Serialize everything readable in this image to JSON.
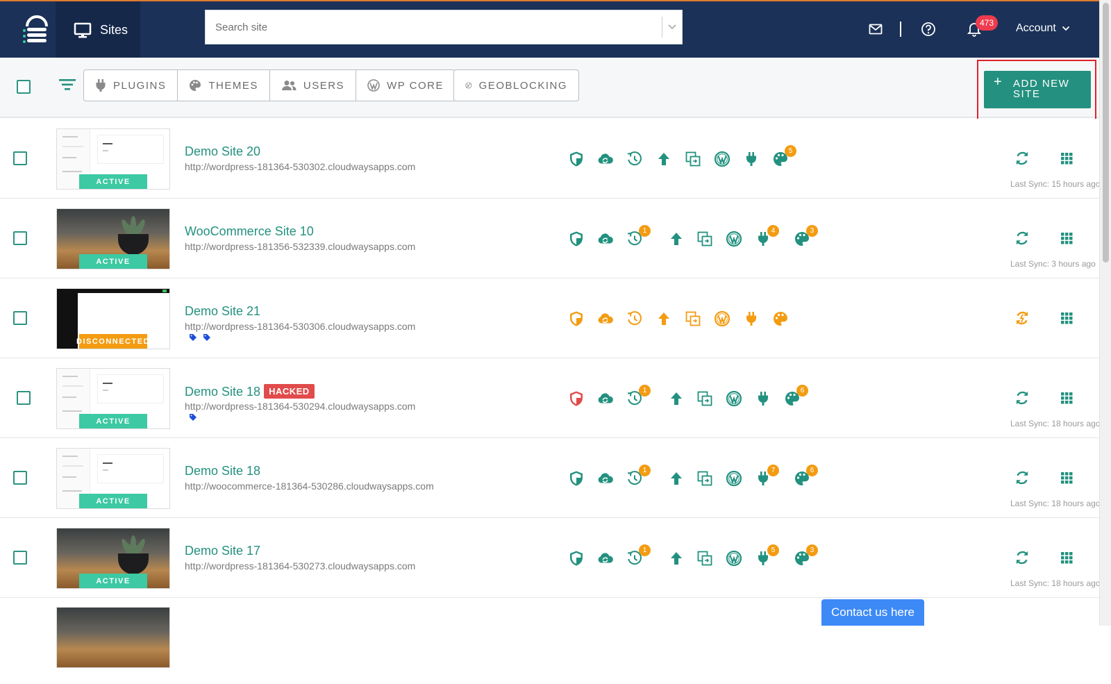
{
  "header": {
    "nav_label": "Sites",
    "search_placeholder": "Search site",
    "notifications_count": "473",
    "account_label": "Account"
  },
  "toolbar": {
    "buttons": [
      "PLUGINS",
      "THEMES",
      "USERS",
      "WP CORE"
    ],
    "geoblocking_label": "GEOBLOCKING",
    "add_new_site_label": "ADD NEW SITE"
  },
  "status_labels": {
    "active": "ACTIVE",
    "disconnected": "DISCONNECTED",
    "hacked": "HACKED"
  },
  "colors": {
    "teal": "#23917f",
    "orange": "#f39c12",
    "red": "#e24b4b",
    "nav": "#1b3158"
  },
  "sites": [
    {
      "name": "Demo Site 20",
      "url": "http://wordpress-181364-530302.cloudwaysapps.com",
      "status": "ACTIVE",
      "thumb": "doc",
      "hacked": false,
      "backup_badge": "",
      "plugin_badge": "",
      "theme_badge": "5",
      "last_sync": "Last Sync: 15 hours ago",
      "tags": 0
    },
    {
      "name": "WooCommerce Site 10",
      "url": "http://wordpress-181356-532339.cloudwaysapps.com",
      "status": "ACTIVE",
      "thumb": "photo",
      "hacked": false,
      "backup_badge": "1",
      "plugin_badge": "4",
      "theme_badge": "3",
      "last_sync": "Last Sync: 3 hours ago",
      "tags": 0
    },
    {
      "name": "Demo Site 21",
      "url": "http://wordpress-181364-530306.cloudwaysapps.com",
      "status": "DISCONNECTED",
      "thumb": "dark",
      "hacked": false,
      "backup_badge": "",
      "plugin_badge": "",
      "theme_badge": "",
      "last_sync": "",
      "tags": 2
    },
    {
      "name": "Demo Site 18",
      "url": "http://wordpress-181364-530294.cloudwaysapps.com",
      "status": "ACTIVE",
      "thumb": "doc",
      "hacked": true,
      "backup_badge": "1",
      "plugin_badge": "",
      "theme_badge": "6",
      "last_sync": "Last Sync: 18 hours ago",
      "tags": 1
    },
    {
      "name": "Demo Site 18",
      "url": "http://woocommerce-181364-530286.cloudwaysapps.com",
      "status": "ACTIVE",
      "thumb": "doc",
      "hacked": false,
      "backup_badge": "1",
      "plugin_badge": "7",
      "theme_badge": "6",
      "last_sync": "Last Sync: 18 hours ago",
      "tags": 0
    },
    {
      "name": "Demo Site 17",
      "url": "http://wordpress-181364-530273.cloudwaysapps.com",
      "status": "ACTIVE",
      "thumb": "photo",
      "hacked": false,
      "backup_badge": "1",
      "plugin_badge": "5",
      "theme_badge": "3",
      "last_sync": "Last Sync: 18 hours ago",
      "tags": 0
    }
  ],
  "contact_label": "Contact us here"
}
